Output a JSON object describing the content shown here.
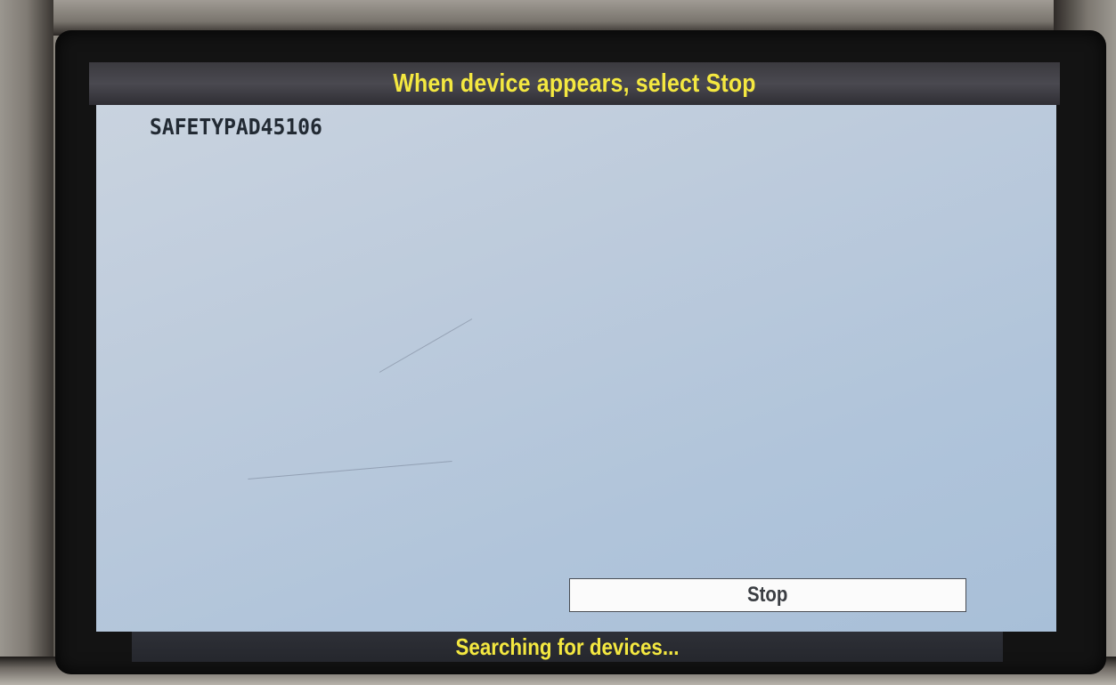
{
  "header": {
    "title": "When device appears, select Stop"
  },
  "device_list": {
    "items": [
      {
        "label": "SAFETYPAD45106"
      }
    ]
  },
  "actions": {
    "stop_label": "Stop"
  },
  "status": {
    "text": "Searching for devices..."
  },
  "colors": {
    "title_text": "#f4e840",
    "status_text": "#f4e840",
    "display_background": "#bdcbdc",
    "button_background": "#fbfbfb"
  }
}
